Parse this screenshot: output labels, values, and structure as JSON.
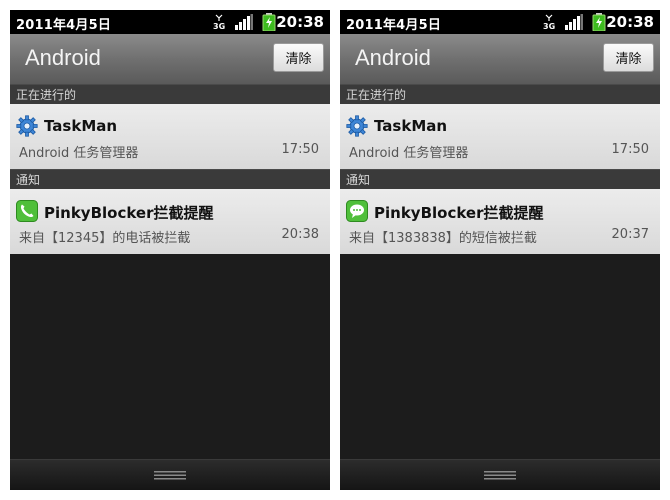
{
  "screens": [
    {
      "status_bar": {
        "date": "2011年4月5日",
        "time": "20:38"
      },
      "header": {
        "title": "Android",
        "clear_label": "清除"
      },
      "sections": [
        {
          "label": "正在进行的"
        },
        {
          "label": "通知"
        }
      ],
      "notifications": [
        {
          "icon": "gear-icon",
          "title": "TaskMan",
          "text": "Android 任务管理器",
          "time": "17:50"
        },
        {
          "icon": "phone-icon",
          "title": "PinkyBlocker拦截提醒",
          "text": "来自【12345】的电话被拦截",
          "time": "20:38"
        }
      ]
    },
    {
      "status_bar": {
        "date": "2011年4月5日",
        "time": "20:38"
      },
      "header": {
        "title": "Android",
        "clear_label": "清除"
      },
      "sections": [
        {
          "label": "正在进行的"
        },
        {
          "label": "通知"
        }
      ],
      "notifications": [
        {
          "icon": "gear-icon",
          "title": "TaskMan",
          "text": "Android 任务管理器",
          "time": "17:50"
        },
        {
          "icon": "sms-icon",
          "title": "PinkyBlocker拦截提醒",
          "text": "来自【1383838】的短信被拦截",
          "time": "20:37"
        }
      ]
    }
  ],
  "colors": {
    "status_bar": "#000000",
    "header": "#707070",
    "section_header": "#3a3a3a",
    "notification_bg": "#e3e3e3",
    "panel_bg": "#1c1c1c"
  }
}
